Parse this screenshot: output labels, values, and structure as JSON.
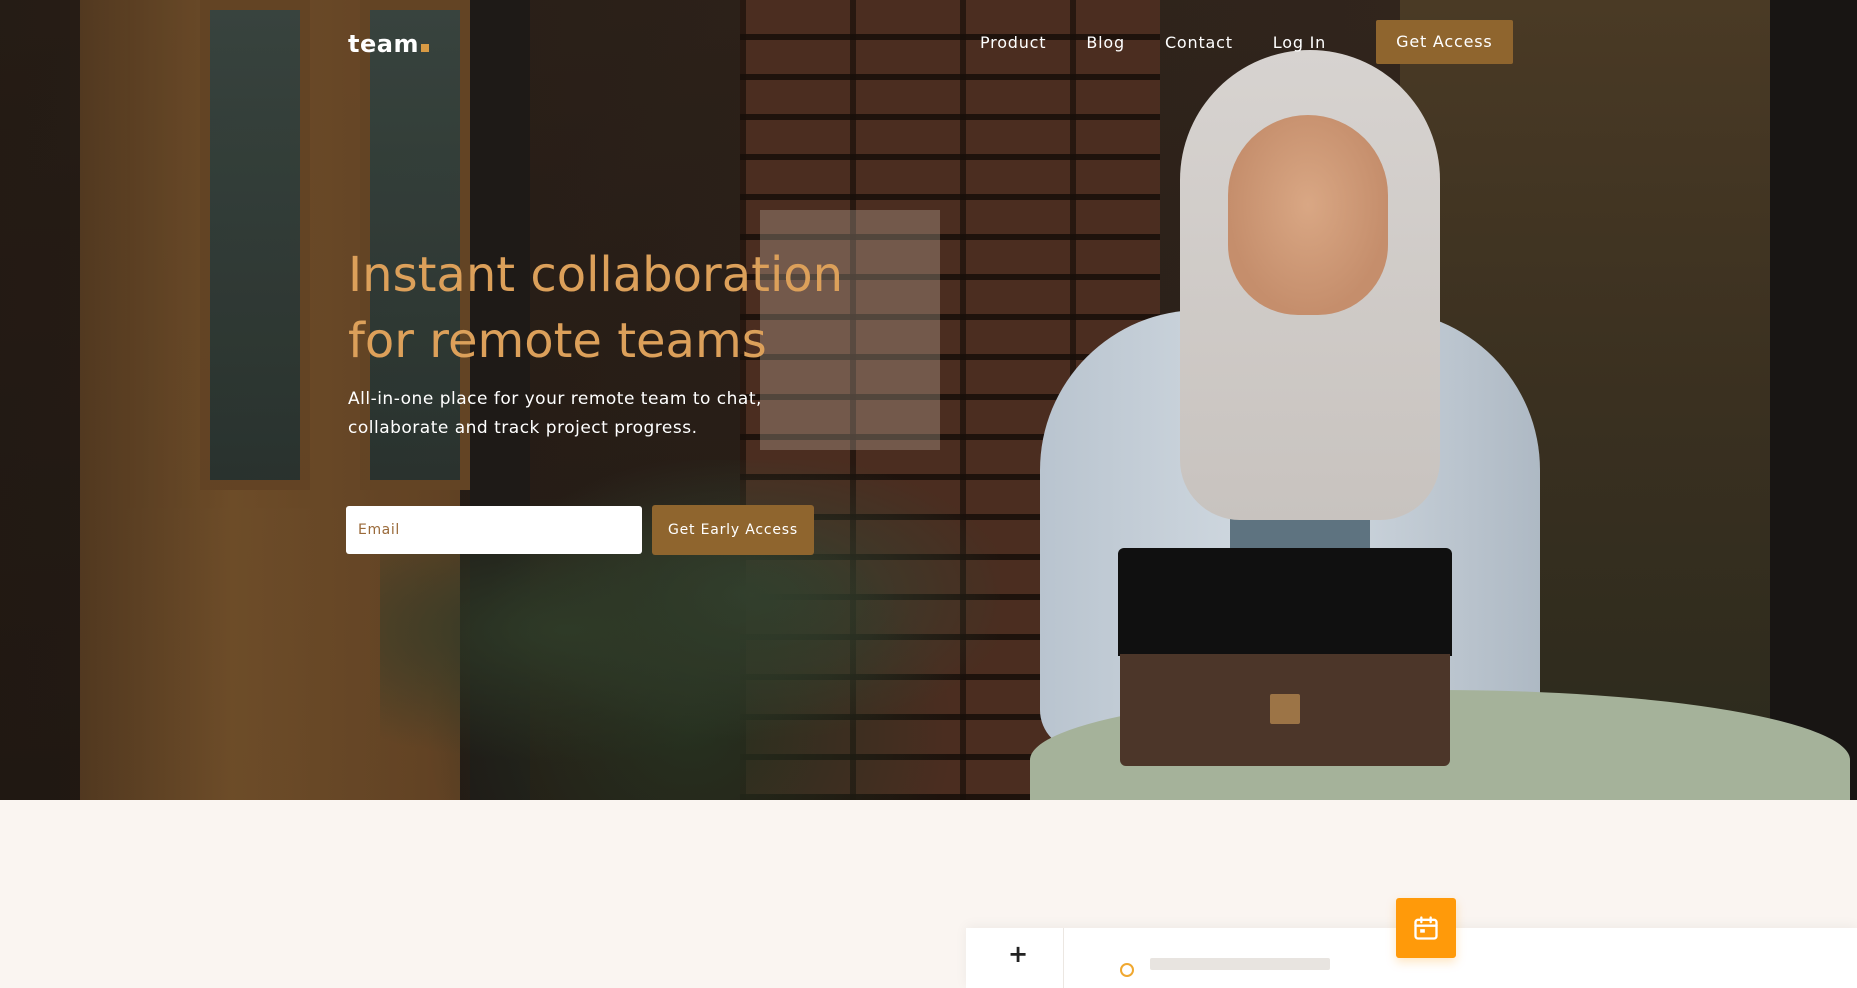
{
  "brand": {
    "logo_text": "team",
    "accent_color": "#d89a44",
    "button_color": "#8f652e"
  },
  "nav": {
    "links": [
      {
        "label": "Product"
      },
      {
        "label": "Blog"
      },
      {
        "label": "Contact"
      },
      {
        "label": "Log In"
      }
    ],
    "cta_label": "Get Access"
  },
  "hero": {
    "title": "Instant collaboration for remote teams",
    "subtitle": "All-in-one place for your remote team to chat, collaborate and track project progress.",
    "email_placeholder": "Email",
    "signup_label": "Get Early Access",
    "title_color": "#dca05a"
  },
  "lower": {
    "calendar_icon": "calendar-icon",
    "calendar_color": "#ff9a0a",
    "plus_icon": "plus-icon"
  }
}
